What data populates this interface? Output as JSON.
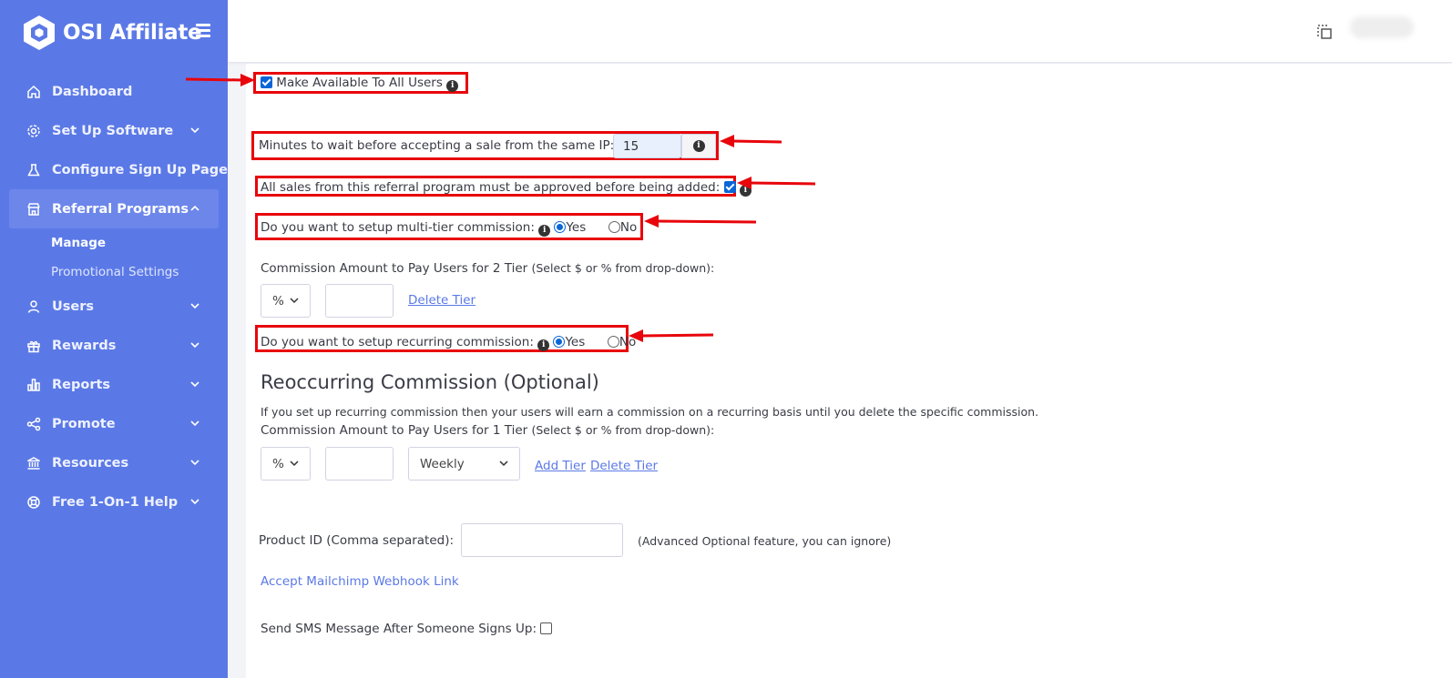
{
  "brand": {
    "name": "OSI Affiliate"
  },
  "sidebar": {
    "items": [
      {
        "label": "Dashboard",
        "icon": "home-icon",
        "has_chevron": false
      },
      {
        "label": "Set Up Software",
        "icon": "gear-icon",
        "has_chevron": true
      },
      {
        "label": "Configure Sign Up Page",
        "icon": "flask-icon",
        "has_chevron": false
      },
      {
        "label": "Referral Programs",
        "icon": "store-icon",
        "has_chevron": true,
        "active": true
      },
      {
        "label": "Users",
        "icon": "user-icon",
        "has_chevron": true
      },
      {
        "label": "Rewards",
        "icon": "gift-icon",
        "has_chevron": true
      },
      {
        "label": "Reports",
        "icon": "bar-chart-icon",
        "has_chevron": true
      },
      {
        "label": "Promote",
        "icon": "share-icon",
        "has_chevron": true
      },
      {
        "label": "Resources",
        "icon": "bank-icon",
        "has_chevron": true
      },
      {
        "label": "Free 1-On-1 Help",
        "icon": "lifebuoy-icon",
        "has_chevron": true
      }
    ],
    "subitems": [
      {
        "label": "Manage",
        "current": true
      },
      {
        "label": "Promotional Settings",
        "current": false
      }
    ]
  },
  "form": {
    "make_available": {
      "label": "Make Available To All Users",
      "checked": true
    },
    "wait_minutes": {
      "label": "Minutes to wait before accepting a sale from the same IP:",
      "value": "15"
    },
    "approve_sales": {
      "label": "All sales from this referral program must be approved before being added:",
      "checked": true
    },
    "multi_tier": {
      "label": "Do you want to setup multi-tier commission:",
      "yes": "Yes",
      "no": "No",
      "selected": "Yes"
    },
    "tier2": {
      "label": "Commission Amount to Pay Users for 2 Tier",
      "hint": "(Select $ or % from drop-down):",
      "unit": "%",
      "amount": "",
      "delete_link": "Delete Tier"
    },
    "recurring": {
      "label": "Do you want to setup recurring commission:",
      "yes": "Yes",
      "no": "No",
      "selected": "Yes"
    },
    "reoccurring_section": {
      "title": "Reoccurring Commission (Optional)",
      "description": "If you set up recurring commission then your users will earn a commission on a recurring basis until you delete the specific commission.",
      "tier1_label": "Commission Amount to Pay Users for 1 Tier",
      "tier1_hint": "(Select $ or % from drop-down):",
      "unit": "%",
      "amount": "",
      "frequency": "Weekly",
      "add_link": "Add Tier",
      "delete_link": "Delete Tier"
    },
    "product_id": {
      "label": "Product ID (Comma separated):",
      "value": "",
      "note": "(Advanced Optional feature, you can ignore)"
    },
    "mailchimp_link": "Accept Mailchimp Webhook Link",
    "sms": {
      "label": "Send SMS Message After Someone Signs Up:",
      "checked": false
    }
  },
  "colors": {
    "sidebar": "#5b79e6",
    "accent": "#5b79e6",
    "annotation": "#e8050b",
    "checkbox": "#0a66d8"
  }
}
